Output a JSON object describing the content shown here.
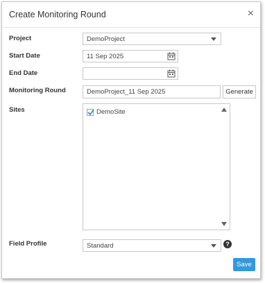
{
  "dialog": {
    "title": "Create Monitoring Round",
    "close_symbol": "×"
  },
  "form": {
    "project": {
      "label": "Project",
      "value": "DemoProject"
    },
    "start_date": {
      "label": "Start Date",
      "value": "11 Sep 2025"
    },
    "end_date": {
      "label": "End Date",
      "value": ""
    },
    "monitoring_round": {
      "label": "Monitoring Round",
      "value": "DemoProject_11 Sep 2025",
      "generate_label": "Generate"
    },
    "sites": {
      "label": "Sites",
      "items": [
        {
          "label": "DemoSite",
          "checked": true
        }
      ]
    },
    "field_profile": {
      "label": "Field Profile",
      "value": "Standard",
      "help_symbol": "?"
    }
  },
  "footer": {
    "save_label": "Save"
  },
  "icons": {
    "close": "close-icon",
    "calendar": "calendar-icon",
    "dropdown": "chevron-down-icon",
    "help": "help-icon",
    "check": "check-icon"
  },
  "colors": {
    "save_button": "#3399dd",
    "check": "#3a7bd5"
  }
}
